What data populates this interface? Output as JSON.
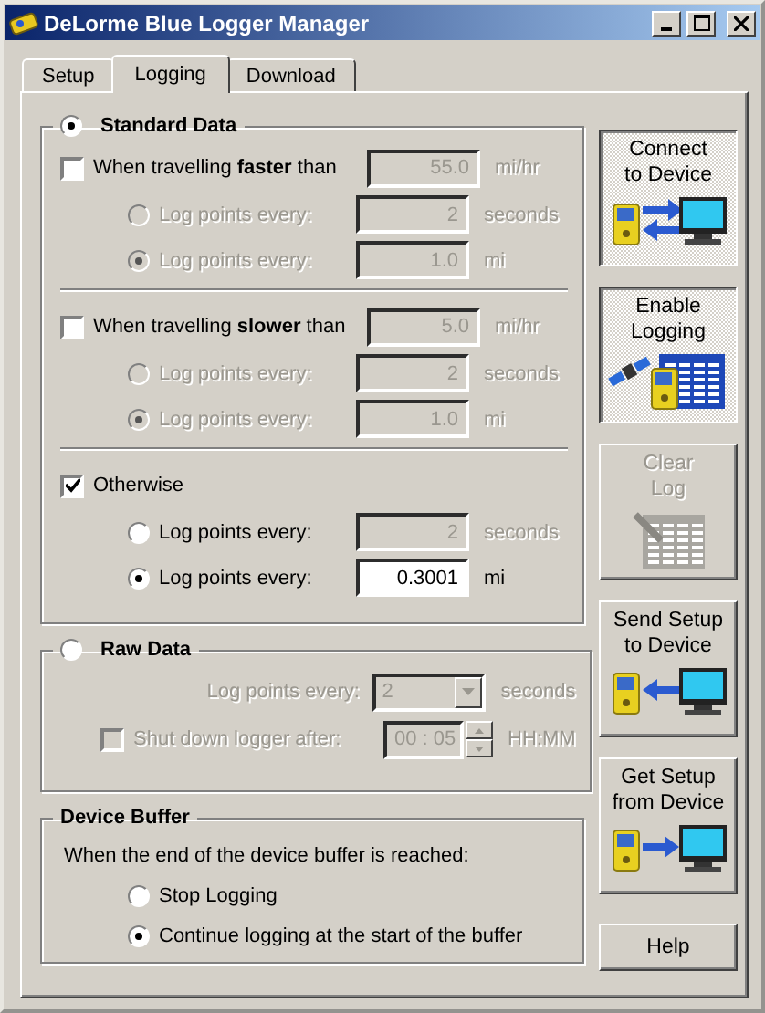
{
  "window": {
    "title": "DeLorme Blue Logger Manager"
  },
  "tabs": [
    {
      "label": "Setup",
      "selected": false
    },
    {
      "label": "Logging",
      "selected": true
    },
    {
      "label": "Download",
      "selected": false
    }
  ],
  "standard_data": {
    "label": "Standard Data",
    "selected": true,
    "rules": [
      {
        "label": "When travelling **faster** than",
        "checked": false,
        "value": "55.0",
        "unit": "mi/hr",
        "options": [
          {
            "label": "Log points every:",
            "selected": false,
            "value": "2",
            "unit": "seconds"
          },
          {
            "label": "Log points every:",
            "selected": true,
            "value": "1.0",
            "unit": "mi"
          }
        ]
      },
      {
        "label": "When travelling **slower** than",
        "checked": false,
        "value": "5.0",
        "unit": "mi/hr",
        "options": [
          {
            "label": "Log points every:",
            "selected": false,
            "value": "2",
            "unit": "seconds"
          },
          {
            "label": "Log points every:",
            "selected": true,
            "value": "1.0",
            "unit": "mi"
          }
        ]
      },
      {
        "label": "Otherwise",
        "checked": true,
        "options": [
          {
            "label": "Log points every:",
            "selected": false,
            "value": "2",
            "unit": "seconds"
          },
          {
            "label": "Log points every:",
            "selected": true,
            "value": "0.3001",
            "unit": "mi"
          }
        ]
      }
    ]
  },
  "raw_data": {
    "label": "Raw Data",
    "selected": false,
    "interval_label": "Log points every:",
    "interval_value": "2",
    "interval_unit": "seconds",
    "shutdown_label": "Shut down logger after:",
    "shutdown_checked": false,
    "shutdown_value": "00 : 05",
    "shutdown_unit": "HH:MM"
  },
  "device_buffer": {
    "label": "Device Buffer",
    "prompt": "When the end of the device buffer is reached:",
    "options": [
      {
        "label": "Stop Logging",
        "selected": false
      },
      {
        "label": "Continue logging at the start of the buffer",
        "selected": true
      }
    ]
  },
  "actions": [
    {
      "kind": "connect",
      "lines": [
        "Connect",
        "to Device"
      ],
      "pressed": true,
      "disabled": false
    },
    {
      "kind": "enable",
      "lines": [
        "Enable",
        "Logging"
      ],
      "pressed": true,
      "disabled": false
    },
    {
      "kind": "clear",
      "lines": [
        "Clear",
        "Log"
      ],
      "pressed": false,
      "disabled": true
    },
    {
      "kind": "send",
      "lines": [
        "Send Setup",
        "to Device"
      ],
      "pressed": false,
      "disabled": false
    },
    {
      "kind": "get",
      "lines": [
        "Get Setup",
        "from Device"
      ],
      "pressed": false,
      "disabled": false
    },
    {
      "kind": "help",
      "lines": [
        "Help"
      ],
      "pressed": false,
      "disabled": false
    }
  ]
}
